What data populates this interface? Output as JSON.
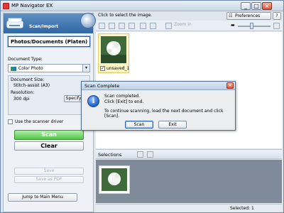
{
  "window": {
    "title": "MP Navigator EX",
    "controls": [
      "_",
      "□",
      "×"
    ]
  },
  "sidebar": {
    "header_label": "Scan/Import",
    "mode": "Photos/Documents (Platen)",
    "document_type_label": "Document Type:",
    "document_type_value": "Color Photo",
    "document_size_label": "Document Size:",
    "document_size_value": "Stitch-assist (A3)",
    "resolution_label": "Resolution:",
    "resolution_value": "300 dpi",
    "specify_label": "Specify...",
    "scanner_driver_label": "Use the scanner driver",
    "scan_label": "Scan",
    "clear_label": "Clear",
    "save_label": "Save",
    "save_pdf_label": "Save as PDF",
    "jump_label": "Jump to Main Menu"
  },
  "main": {
    "hint": "Click to select the image.",
    "preferences_label": "Preferences",
    "help_icon": "?",
    "zoom_label": "Zoom in",
    "thumbnail_name": "unsaved_1",
    "selections_label": "Selections",
    "status_text": "Selected: 1"
  },
  "dialog": {
    "title": "Scan Complete",
    "line1": "Scan completed.",
    "line2": "Click [Exit] to end.",
    "line3": "To continue scanning, load the next document and click [Scan].",
    "scan_button": "Scan",
    "exit_button": "Exit",
    "icon": "i"
  },
  "colors": {
    "accent": "#2f66a3",
    "scan_green": "#55c54c",
    "selection_bg": "#7f8b98",
    "thumb_highlight": "#fff6c8"
  }
}
